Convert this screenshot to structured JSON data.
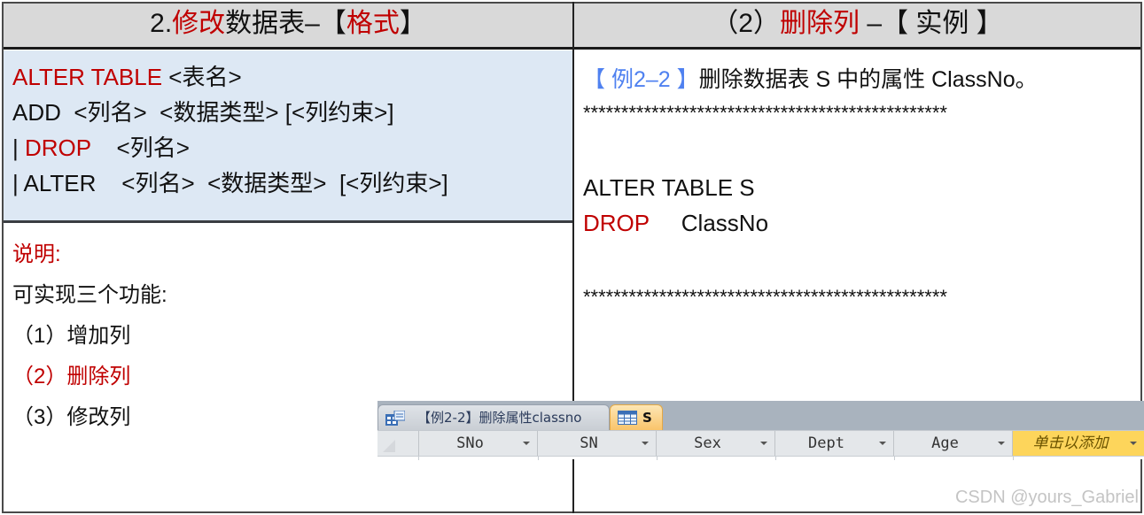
{
  "left_panel": {
    "header": {
      "prefix": "2.",
      "red1": "修改",
      "middle": "数据表–【",
      "red2": "格式",
      "suffix": "】"
    },
    "syntax": [
      {
        "red": "ALTER TABLE",
        "black": " <表名>"
      },
      {
        "red": "",
        "black": "ADD  <列名>  <数据类型> [<列约束>]"
      },
      {
        "prefix": "| ",
        "red": "DROP",
        "black": "    <列名>"
      },
      {
        "red": "",
        "black": "| ALTER    <列名>  <数据类型>  [<列约束>]"
      }
    ],
    "notes": {
      "title": "说明:",
      "intro": "可实现三个功能:",
      "items": [
        {
          "text": "（1）增加列",
          "highlight": false
        },
        {
          "text": "（2）删除列",
          "highlight": true
        },
        {
          "text": "（3）修改列",
          "highlight": false
        }
      ]
    }
  },
  "right_panel": {
    "header": {
      "prefix": "（2）",
      "red": "删除列",
      "suffix": " –【 实例 】"
    },
    "example": {
      "tag": "【 例2–2 】",
      "description": "删除数据表 S 中的属性 ClassNo。",
      "separator": "************************************************",
      "code_line1": "ALTER TABLE S",
      "code_keyword": "DROP",
      "code_arg": "     ClassNo"
    }
  },
  "access_window": {
    "tabs": [
      {
        "label": "【例2-2】删除属性classno",
        "icon": "query-form-icon",
        "active": false
      },
      {
        "label": "S",
        "icon": "table-icon",
        "active": true
      }
    ],
    "columns": [
      "SNo",
      "SN",
      "Sex",
      "Dept",
      "Age"
    ],
    "add_column_label": "单击以添加"
  },
  "watermark": "CSDN @yours_Gabriel",
  "colors": {
    "accent_red": "#c00000",
    "tag_blue": "#4f81f0",
    "syntax_bg": "#dde8f4",
    "header_bg": "#d9d9d9",
    "add_column_bg": "#fdd55b",
    "active_tab": "#f9c46a"
  }
}
